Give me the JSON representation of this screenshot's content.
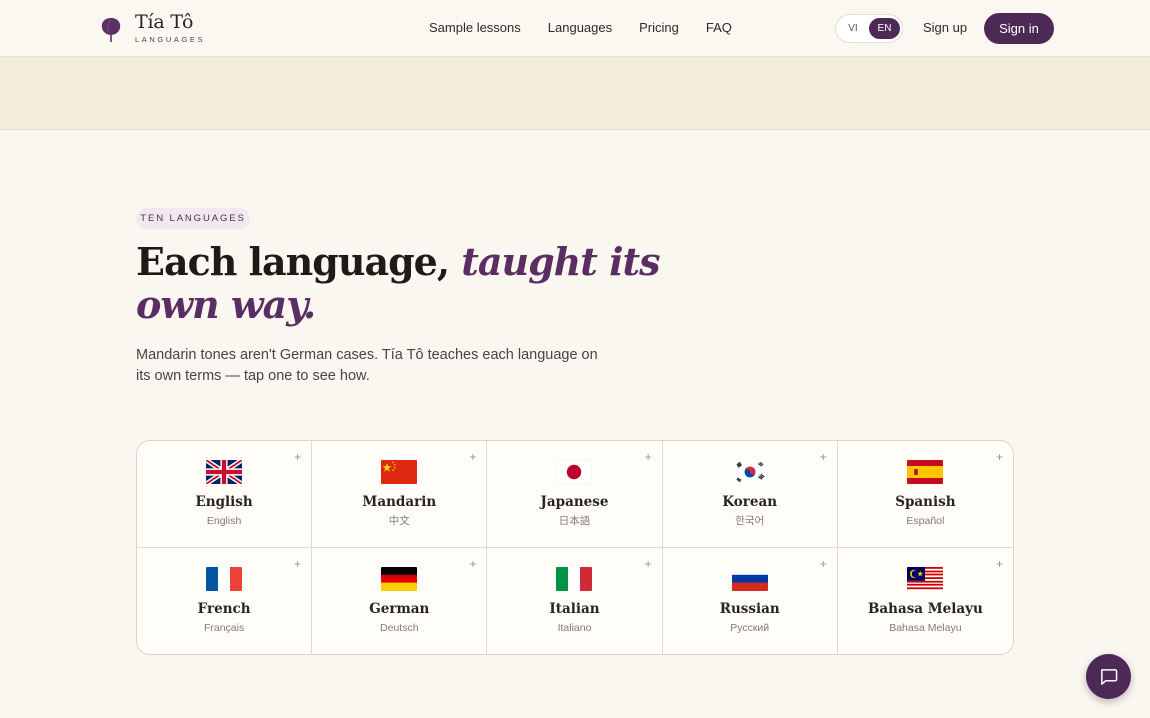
{
  "header": {
    "brand_name": "Tía Tô",
    "brand_sub": "LANGUAGES",
    "nav": [
      "Sample lessons",
      "Languages",
      "Pricing",
      "FAQ"
    ],
    "lang_toggle": {
      "vi": "VI",
      "en": "EN",
      "selected": "EN"
    },
    "sign_up": "Sign up",
    "sign_in": "Sign in"
  },
  "hero": {
    "eyebrow": "TEN LANGUAGES",
    "headline_plain": "Each language, ",
    "headline_accent": "taught its own way.",
    "lead": "Mandarin tones aren't German cases. Tía Tô teaches each language on its own terms — tap one to see how."
  },
  "languages": [
    {
      "name": "English",
      "native": "English",
      "flag": "uk-flag-icon"
    },
    {
      "name": "Mandarin",
      "native": "中文",
      "flag": "china-flag-icon"
    },
    {
      "name": "Japanese",
      "native": "日本語",
      "flag": "japan-flag-icon"
    },
    {
      "name": "Korean",
      "native": "한국어",
      "flag": "korea-flag-icon"
    },
    {
      "name": "Spanish",
      "native": "Español",
      "flag": "spain-flag-icon"
    },
    {
      "name": "French",
      "native": "Français",
      "flag": "france-flag-icon"
    },
    {
      "name": "German",
      "native": "Deutsch",
      "flag": "germany-flag-icon"
    },
    {
      "name": "Italian",
      "native": "Italiano",
      "flag": "italy-flag-icon"
    },
    {
      "name": "Russian",
      "native": "Русский",
      "flag": "russia-flag-icon"
    },
    {
      "name": "Bahasa Melayu",
      "native": "Bahasa Melayu",
      "flag": "malaysia-flag-icon"
    }
  ],
  "expand_glyph": "+",
  "colors": {
    "brand": "#4d2a56",
    "accent": "#5a2e62",
    "background": "#faf7f0",
    "banner": "#f2ecdc"
  },
  "chat_icon": "chat-bubble-icon"
}
